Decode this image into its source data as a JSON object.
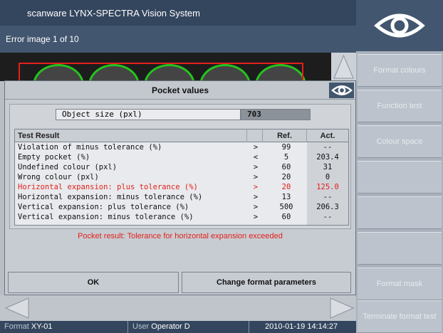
{
  "window": {
    "title": "scanware LYNX-SPECTRA Vision System",
    "subtitle": "Error image 1 of 10"
  },
  "right_panel": {
    "logo_icon": "eye-icon",
    "buttons": [
      {
        "label": "Format colours",
        "enabled": false
      },
      {
        "label": "Function test",
        "enabled": false
      },
      {
        "label": "Colour space",
        "enabled": false
      },
      {
        "label": "",
        "enabled": false
      },
      {
        "label": "",
        "enabled": false
      },
      {
        "label": "",
        "enabled": false
      },
      {
        "label": "Format mask",
        "enabled": false
      },
      {
        "label": "Terminate format test",
        "enabled": false
      }
    ]
  },
  "dialog": {
    "title": "Pocket values",
    "object_size_label": "Object size (pxl)",
    "object_size_value": "703",
    "table": {
      "headers": [
        "Test Result",
        "",
        "Ref.",
        "Act."
      ],
      "rows": [
        {
          "test": "Violation of minus tolerance (%)",
          "op": ">",
          "ref": "99",
          "act": "--",
          "highlight": false
        },
        {
          "test": "Empty pocket (%)",
          "op": "<",
          "ref": "5",
          "act": "203.4",
          "highlight": false
        },
        {
          "test": "Undefined colour (pxl)",
          "op": ">",
          "ref": "60",
          "act": "31",
          "highlight": false
        },
        {
          "test": "Wrong colour (pxl)",
          "op": ">",
          "ref": "20",
          "act": "0",
          "highlight": false
        },
        {
          "test": "Horizontal expansion: plus tolerance (%)",
          "op": ">",
          "ref": "20",
          "act": "125.0",
          "highlight": true
        },
        {
          "test": "Horizontal expansion: minus tolerance (%)",
          "op": ">",
          "ref": "13",
          "act": "--",
          "highlight": false
        },
        {
          "test": "Vertical expansion: plus tolerance (%)",
          "op": ">",
          "ref": "500",
          "act": "206.3",
          "highlight": false
        },
        {
          "test": "Vertical expansion: minus tolerance (%)",
          "op": ">",
          "ref": "60",
          "act": "--",
          "highlight": false
        }
      ]
    },
    "pocket_result": "Pocket result: Tolerance for horizontal expansion exceeded",
    "ok_label": "OK",
    "change_label": "Change format parameters"
  },
  "statusbar": {
    "format_label": "Format",
    "format_value": "XY-01",
    "user_label": "User",
    "user_value": "Operator D",
    "datetime": "2010-01-19 14:14:27"
  },
  "colors": {
    "header": "#34465e",
    "alert": "#e3201b",
    "pocket_outline": "#25c41d"
  }
}
